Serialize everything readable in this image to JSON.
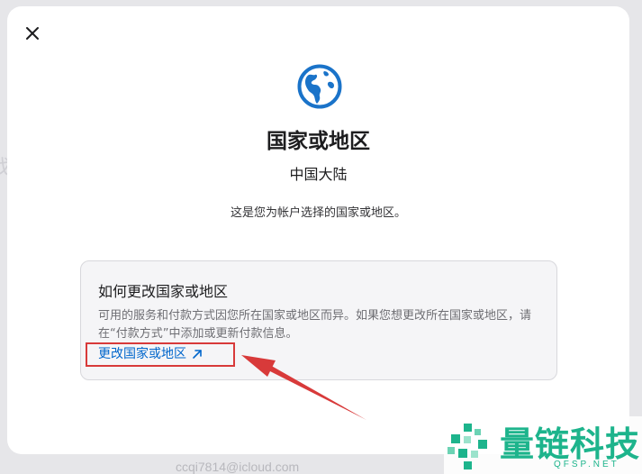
{
  "background": {
    "partial_label": "找",
    "email_text": "ccqi7814@icloud.com"
  },
  "modal": {
    "close_icon": "close-icon",
    "globe_icon": "globe-icon",
    "title": "国家或地区",
    "current_region": "中国大陆",
    "description": "这是您为帐户选择的国家或地区。",
    "info_card": {
      "heading": "如何更改国家或地区",
      "body": "可用的服务和付款方式因您所在国家或地区而异。如果您想更改所在国家或地区，请在“付款方式”中添加或更新付款信息。",
      "link_label": "更改国家或地区",
      "link_icon": "external-arrow-icon"
    }
  },
  "annotation": {
    "highlight_color": "#d83a3a"
  },
  "watermark": {
    "name": "量链科技",
    "domain": "QFSP.NET",
    "color": "#1db48c"
  },
  "colors": {
    "accent": "#0066cc",
    "globe": "#1a73c9",
    "text": "#1d1d1f",
    "muted": "#6e6e73"
  }
}
